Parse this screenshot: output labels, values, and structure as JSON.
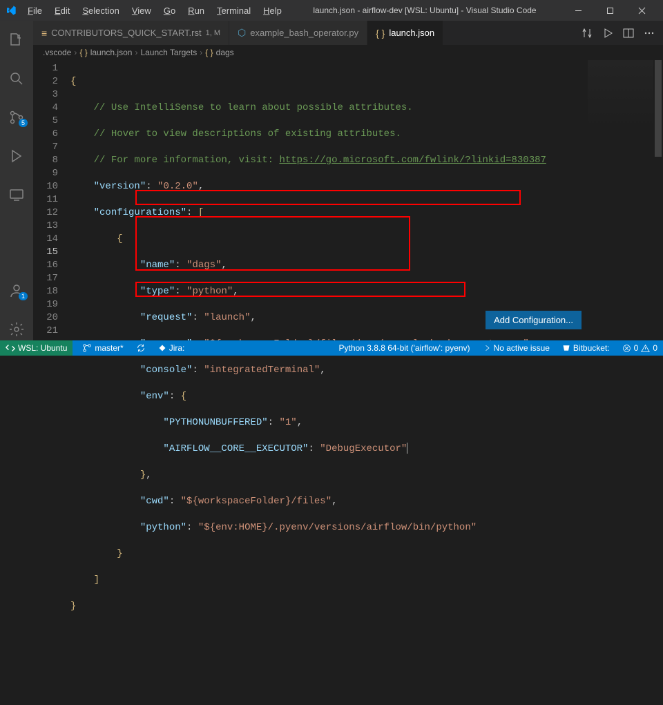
{
  "title": "launch.json - airflow-dev [WSL: Ubuntu] - Visual Studio Code",
  "menus": {
    "file": "File",
    "edit": "Edit",
    "selection": "Selection",
    "view": "View",
    "go": "Go",
    "run": "Run",
    "terminal": "Terminal",
    "help": "Help"
  },
  "tabs": [
    {
      "label": "CONTRIBUTORS_QUICK_START.rst",
      "mods": "1, M",
      "icon_color": "#dcb67a"
    },
    {
      "label": "example_bash_operator.py",
      "icon_color": "#519aba"
    },
    {
      "label": "launch.json",
      "icon_color": "#d7ba7d",
      "active": true
    }
  ],
  "breadcrumb": {
    "items": [
      ".vscode",
      "launch.json",
      "Launch Targets",
      "dags"
    ]
  },
  "activity_badges": {
    "scm": "5",
    "accounts": "1"
  },
  "code": {
    "comment1": "// Use IntelliSense to learn about possible attributes.",
    "comment2": "// Hover to view descriptions of existing attributes.",
    "comment3": "// For more information, visit: ",
    "link": "https://go.microsoft.com/fwlink/?linkid=830387",
    "version_key": "\"version\"",
    "version_val": "\"0.2.0\"",
    "configs_key": "\"configurations\"",
    "name_key": "\"name\"",
    "name_val": "\"dags\"",
    "type_key": "\"type\"",
    "type_val": "\"python\"",
    "request_key": "\"request\"",
    "request_val": "\"launch\"",
    "program_key": "\"program\"",
    "program_val": "\"${workspaceFolder}/files/dags/example_bash_operator.py\"",
    "console_key": "\"console\"",
    "console_val": "\"integratedTerminal\"",
    "env_key": "\"env\"",
    "pyunbuf_key": "\"PYTHONUNBUFFERED\"",
    "pyunbuf_val": "\"1\"",
    "executor_key": "\"AIRFLOW__CORE__EXECUTOR\"",
    "executor_val": "\"DebugExecutor\"",
    "cwd_key": "\"cwd\"",
    "cwd_val": "\"${workspaceFolder}/files\"",
    "python_key": "\"python\"",
    "python_val": "\"${env:HOME}/.pyenv/versions/airflow/bin/python\""
  },
  "add_config_label": "Add Configuration...",
  "statusbar": {
    "remote": "WSL: Ubuntu",
    "branch": "master*",
    "jira": "Jira:",
    "python": "Python 3.8.8 64-bit ('airflow': pyenv)",
    "issue": "No active issue",
    "bitbucket": "Bitbucket:",
    "errors": "0",
    "warnings": "0"
  }
}
